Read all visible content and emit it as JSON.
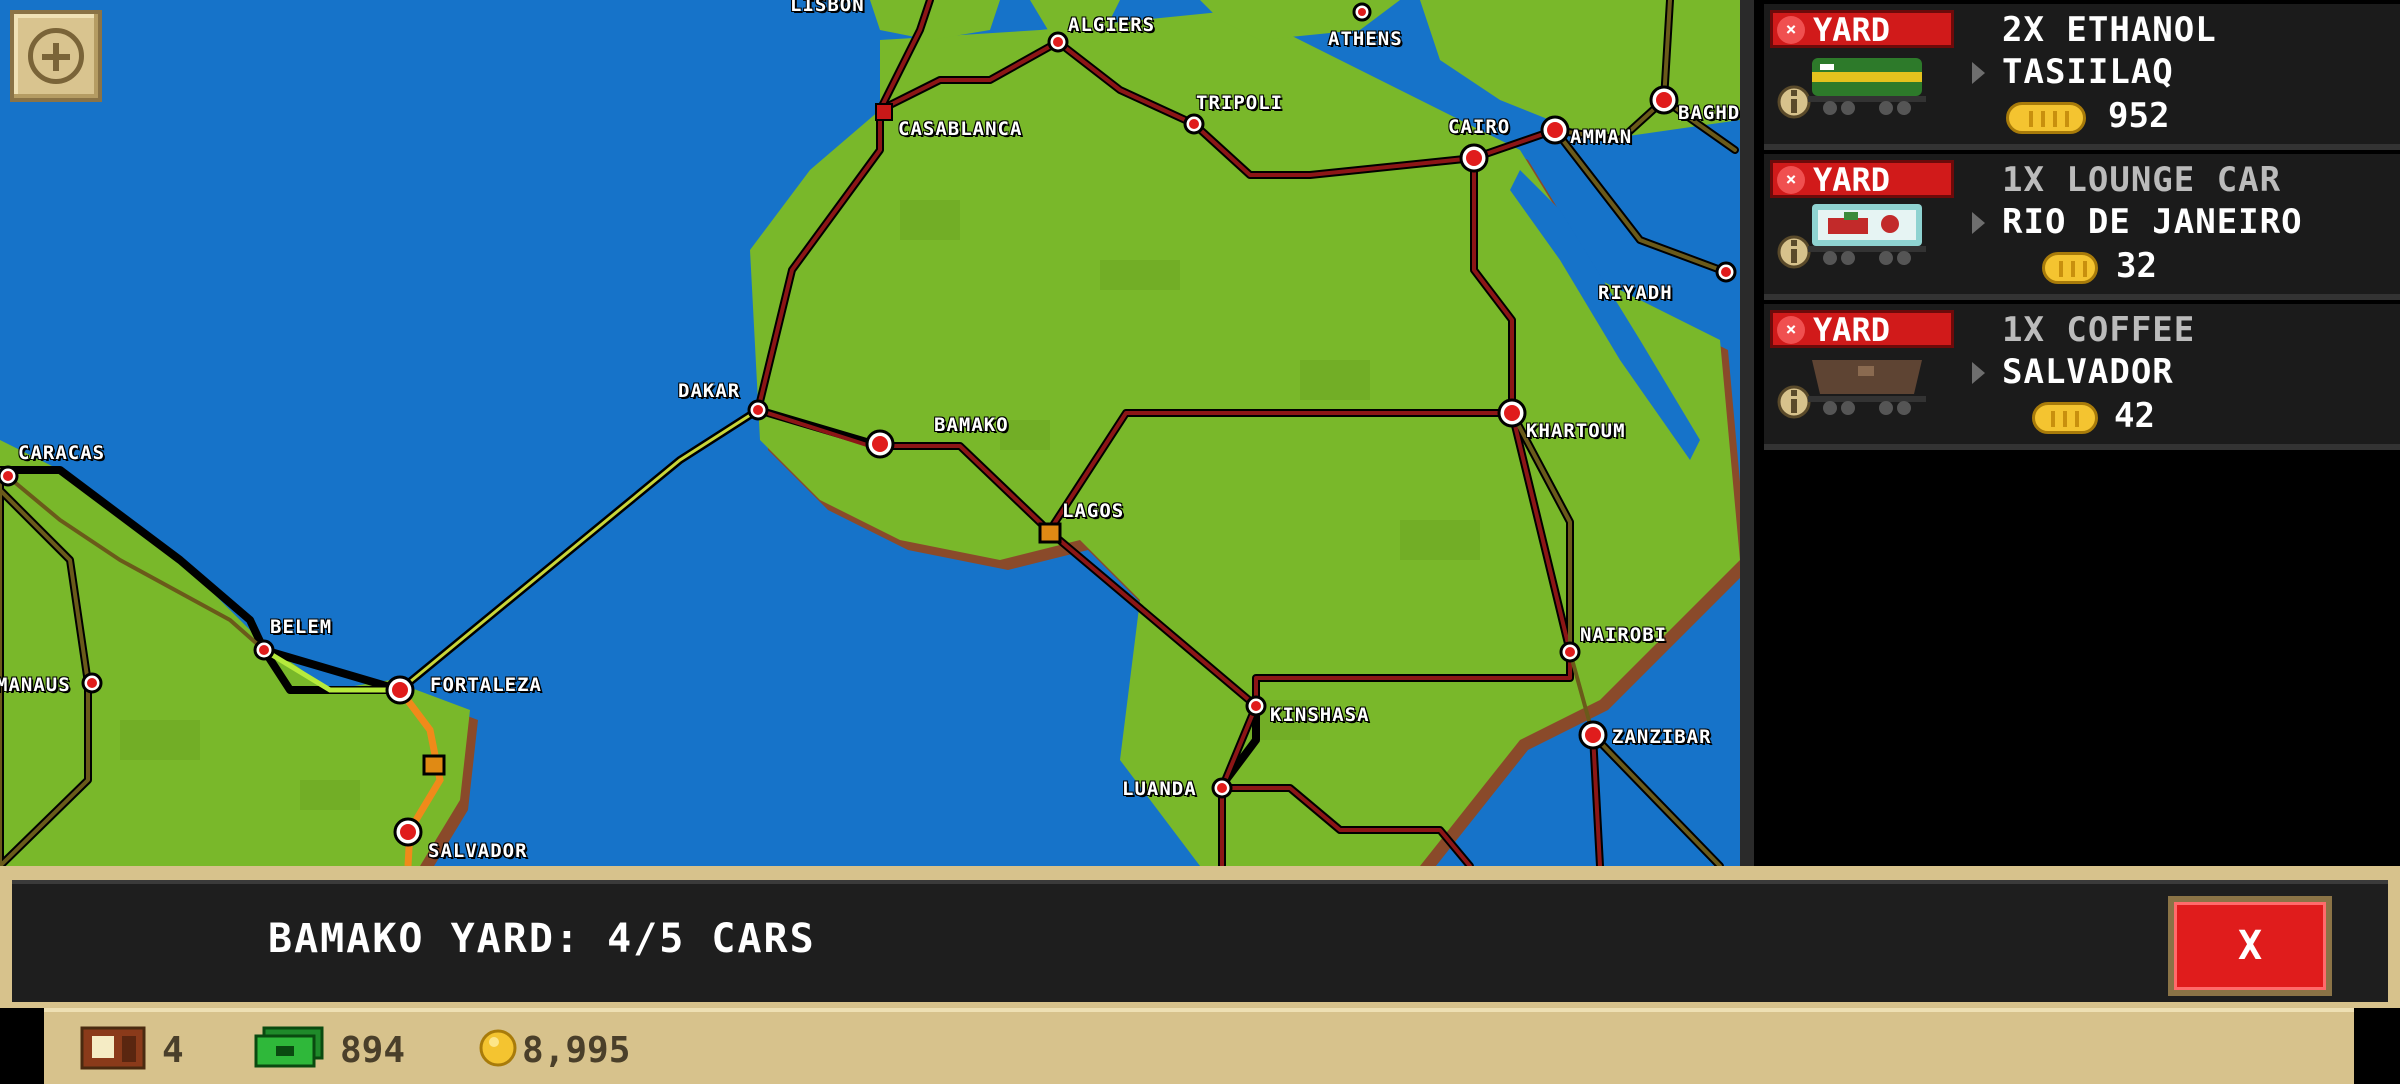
{
  "map": {
    "zoom_icon": "plus-icon",
    "cities": [
      {
        "name": "LISBON"
      },
      {
        "name": "ALGIERS"
      },
      {
        "name": "ATHENS"
      },
      {
        "name": "TRIPOLI"
      },
      {
        "name": "CASABLANCA"
      },
      {
        "name": "CAIRO"
      },
      {
        "name": "AMMAN"
      },
      {
        "name": "BAGHDAD"
      },
      {
        "name": "RIYADH"
      },
      {
        "name": "DAKAR"
      },
      {
        "name": "BAMAKO"
      },
      {
        "name": "KHARTOUM"
      },
      {
        "name": "LAGOS"
      },
      {
        "name": "CARACAS"
      },
      {
        "name": "BELEM"
      },
      {
        "name": "MANAUS"
      },
      {
        "name": "FORTALEZA"
      },
      {
        "name": "NAIROBI"
      },
      {
        "name": "KINSHASA"
      },
      {
        "name": "ZANZIBAR"
      },
      {
        "name": "LUANDA"
      },
      {
        "name": "SALVADOR"
      }
    ]
  },
  "yard_list": [
    {
      "badge": "YARD",
      "title": "2X ETHANOL",
      "destination": "TASIILAQ",
      "reward": "952",
      "car_color": "#e4c21e"
    },
    {
      "badge": "YARD",
      "title": "1X LOUNGE CAR",
      "destination": "RIO DE JANEIRO",
      "reward": "32",
      "car_color": "#8fd3d1"
    },
    {
      "badge": "YARD",
      "title": "1X COFFEE",
      "destination": "SALVADOR",
      "reward": "42",
      "car_color": "#5e4433"
    }
  ],
  "status": {
    "text": "BAMAKO YARD: 4/5 CARS",
    "close_label": "X"
  },
  "resources": {
    "cars": "4",
    "cash": "894",
    "gold": "8,995"
  },
  "colors": {
    "ocean": "#1673c9",
    "land": "#79b82a",
    "rail_red": "#8c1616",
    "badge_red": "#d11a1a",
    "frame_tan": "#d7c28c"
  }
}
